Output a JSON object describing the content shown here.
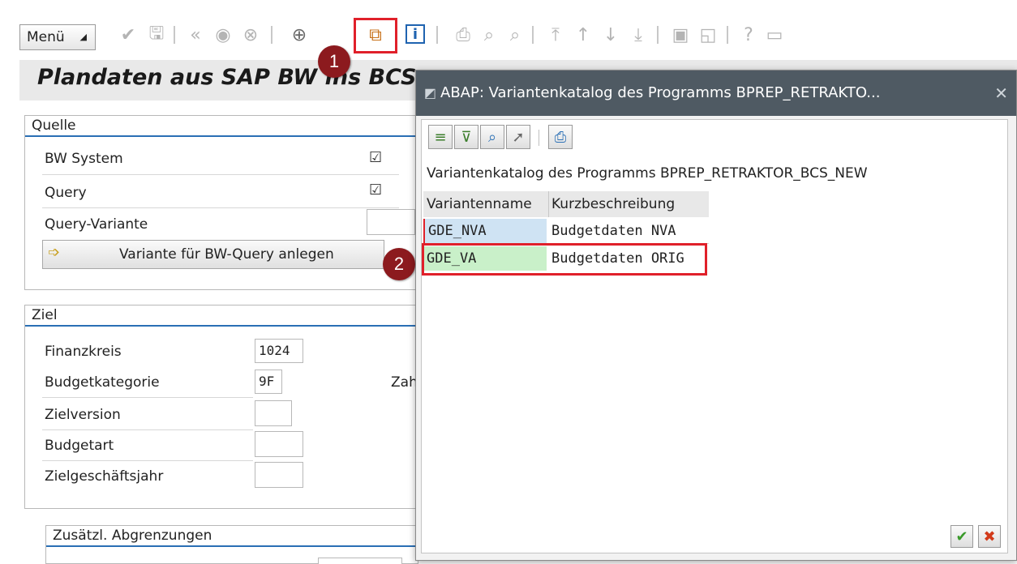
{
  "toolbar": {
    "menu_label": "Menü",
    "badge_1": "1",
    "badge_2": "2"
  },
  "page": {
    "title": "Plandaten aus SAP BW ins BCS"
  },
  "quelle": {
    "header": "Quelle",
    "bw_system_label": "BW System",
    "bw_system_checked": "☑",
    "query_label": "Query",
    "query_checked": "☑",
    "query_variante_label": "Query-Variante",
    "query_variante_value": "",
    "create_button_label": "Variante für BW-Query anlegen"
  },
  "ziel": {
    "header": "Ziel",
    "finanzkreis_label": "Finanzkreis",
    "finanzkreis_value": "1024",
    "budgetkategorie_label": "Budgetkategorie",
    "budgetkategorie_value": "9F",
    "zah_label": "Zah",
    "zielversion_label": "Zielversion",
    "zielversion_value": "",
    "budgetart_label": "Budgetart",
    "budgetart_value": "",
    "zielgeschaeftsjahr_label": "Zielgeschäftsjahr",
    "zielgeschaeftsjahr_value": ""
  },
  "abgrenzungen": {
    "header": "Zusätzl. Abgrenzungen"
  },
  "dialog": {
    "title": "ABAP: Variantenkatalog des Programms BPREP_RETRAKTO...",
    "close_glyph": "✕",
    "subtitle": "Variantenkatalog des Programms BPREP_RETRAKTOR_BCS_NEW",
    "columns": [
      "Variantenname",
      "Kurzbeschreibung"
    ],
    "rows": [
      {
        "name": "GDE_NVA",
        "description": "Budgetdaten NVA"
      },
      {
        "name": "GDE_VA",
        "description": "Budgetdaten ORIG"
      }
    ],
    "ok_glyph": "✔",
    "cancel_glyph": "✖"
  },
  "colors": {
    "accent_blue": "#2a6fb5",
    "highlight_red": "#e0202a",
    "badge_red": "#8c1a1e",
    "dialog_title_bg": "#4f5a63",
    "row_selected_blue": "#cfe3f3",
    "row_selected_green": "#c9f0c9"
  }
}
